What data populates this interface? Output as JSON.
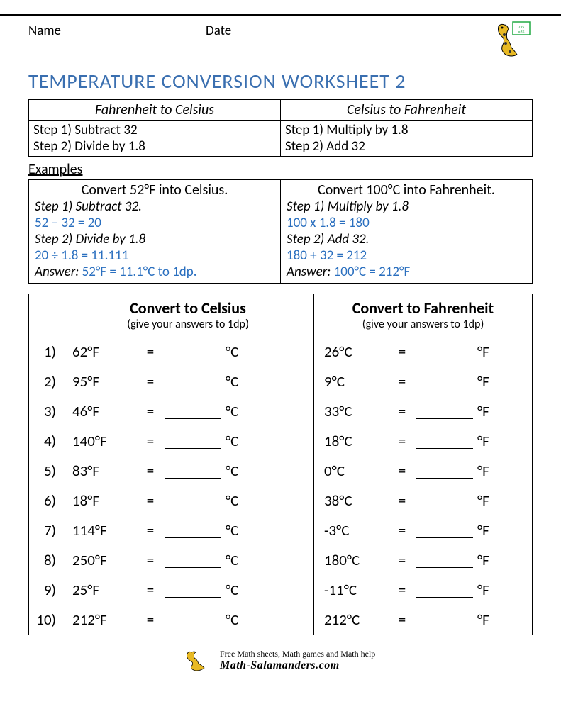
{
  "header": {
    "name_label": "Name",
    "date_label": "Date"
  },
  "title": "TEMPERATURE CONVERSION WORKSHEET 2",
  "rules": {
    "left": {
      "heading": "Fahrenheit to Celsius",
      "step1": "Step 1) Subtract 32",
      "step2": "Step 2) Divide by 1.8"
    },
    "right": {
      "heading": "Celsius to Fahrenheit",
      "step1": "Step 1) Multiply by 1.8",
      "step2": "Step 2) Add 32"
    }
  },
  "examples_label": "Examples",
  "examples": {
    "left": {
      "heading": "Convert 52°F into Celsius.",
      "step1_label": "Step 1) Subtract 32.",
      "step1_calc": "52 – 32 = 20",
      "step2_label": "Step 2) Divide by 1.8",
      "step2_calc": "20 ÷ 1.8 = 11.111",
      "answer_label": "Answer:",
      "answer_value": "52°F = 11.1°C to 1dp."
    },
    "right": {
      "heading": "Convert 100°C into Fahrenheit.",
      "step1_label": "Step 1) Multiply by 1.8",
      "step1_calc": "100 x 1.8 = 180",
      "step2_label": "Step 2) Add 32.",
      "step2_calc": "180 + 32 = 212",
      "answer_label": "Answer:",
      "answer_value": "100°C = 212°F"
    }
  },
  "problems": {
    "left_heading": "Convert to Celsius",
    "right_heading": "Convert to Fahrenheit",
    "subnote": "(give your answers to 1dp)",
    "unit_c": "°C",
    "unit_f": "°F",
    "eq": "=",
    "rows": [
      {
        "n": "1)",
        "f": "62°F",
        "c": "26°C"
      },
      {
        "n": "2)",
        "f": "95°F",
        "c": "9°C"
      },
      {
        "n": "3)",
        "f": "46°F",
        "c": "33°C"
      },
      {
        "n": "4)",
        "f": "140°F",
        "c": "18°C"
      },
      {
        "n": "5)",
        "f": "83°F",
        "c": "0°C"
      },
      {
        "n": "6)",
        "f": "18°F",
        "c": "38°C"
      },
      {
        "n": "7)",
        "f": "114°F",
        "c": "-3°C"
      },
      {
        "n": "8)",
        "f": "250°F",
        "c": "180°C"
      },
      {
        "n": "9)",
        "f": "25°F",
        "c": "-11°C"
      },
      {
        "n": "10)",
        "f": "212°F",
        "c": "212°C"
      }
    ]
  },
  "footer": {
    "line1": "Free Math sheets, Math games and Math help",
    "line2": "Math-Salamanders.com"
  }
}
